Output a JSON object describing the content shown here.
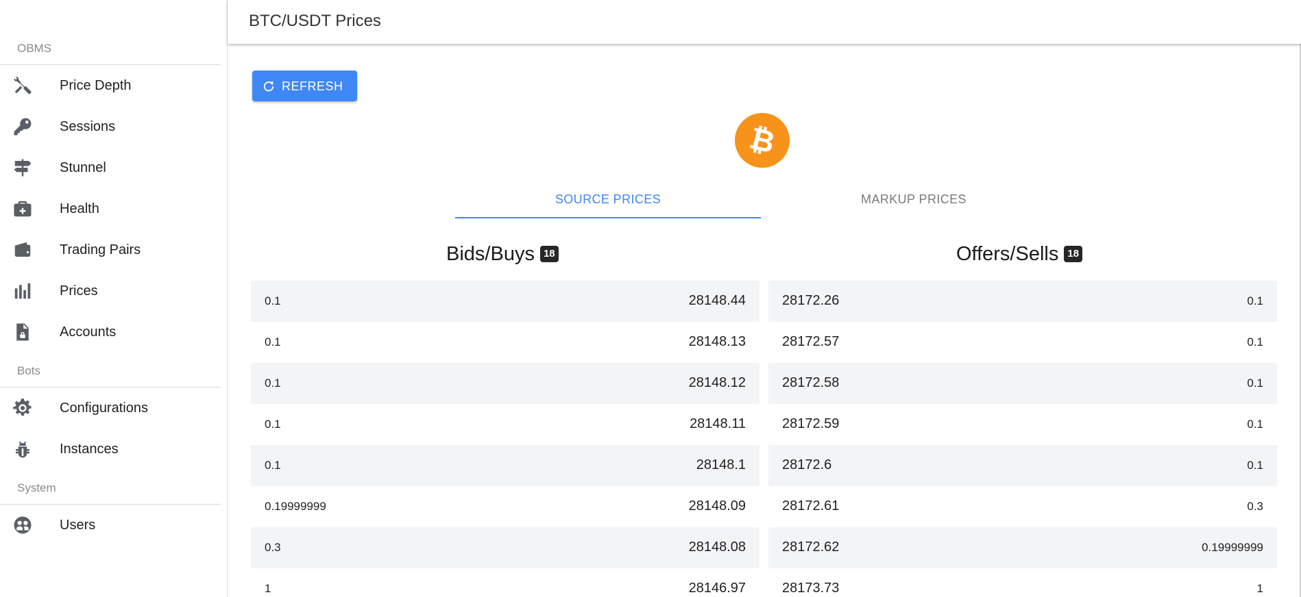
{
  "sidebar": {
    "sections": [
      {
        "header": "OBMS",
        "items": [
          {
            "label": "Price Depth",
            "icon": "tools-icon"
          },
          {
            "label": "Sessions",
            "icon": "key-icon"
          },
          {
            "label": "Stunnel",
            "icon": "signpost-icon"
          },
          {
            "label": "Health",
            "icon": "medkit-icon"
          },
          {
            "label": "Trading Pairs",
            "icon": "wallet-icon"
          },
          {
            "label": "Prices",
            "icon": "bar-chart-icon"
          },
          {
            "label": "Accounts",
            "icon": "file-lock-icon"
          }
        ]
      },
      {
        "header": "Bots",
        "items": [
          {
            "label": "Configurations",
            "icon": "cog-icon"
          },
          {
            "label": "Instances",
            "icon": "bug-icon"
          }
        ]
      },
      {
        "header": "System",
        "items": [
          {
            "label": "Users",
            "icon": "users-icon"
          }
        ]
      }
    ]
  },
  "header": {
    "title": "BTC/USDT Prices"
  },
  "main": {
    "refresh_label": "REFRESH",
    "coin_icon": "bitcoin-icon",
    "accent_color": "#3f87f5",
    "coin_color": "#f7931a",
    "tabs": [
      {
        "label": "SOURCE PRICES",
        "active": true
      },
      {
        "label": "MARKUP PRICES",
        "active": false
      }
    ],
    "bids": {
      "title": "Bids/Buys",
      "count": "18",
      "rows": [
        {
          "qty": "0.1",
          "price": "28148.44"
        },
        {
          "qty": "0.1",
          "price": "28148.13"
        },
        {
          "qty": "0.1",
          "price": "28148.12"
        },
        {
          "qty": "0.1",
          "price": "28148.11"
        },
        {
          "qty": "0.1",
          "price": "28148.1"
        },
        {
          "qty": "0.19999999",
          "price": "28148.09"
        },
        {
          "qty": "0.3",
          "price": "28148.08"
        },
        {
          "qty": "1",
          "price": "28146.97"
        }
      ]
    },
    "offers": {
      "title": "Offers/Sells",
      "count": "18",
      "rows": [
        {
          "price": "28172.26",
          "qty": "0.1"
        },
        {
          "price": "28172.57",
          "qty": "0.1"
        },
        {
          "price": "28172.58",
          "qty": "0.1"
        },
        {
          "price": "28172.59",
          "qty": "0.1"
        },
        {
          "price": "28172.6",
          "qty": "0.1"
        },
        {
          "price": "28172.61",
          "qty": "0.3"
        },
        {
          "price": "28172.62",
          "qty": "0.19999999"
        },
        {
          "price": "28173.73",
          "qty": "1"
        }
      ]
    }
  }
}
